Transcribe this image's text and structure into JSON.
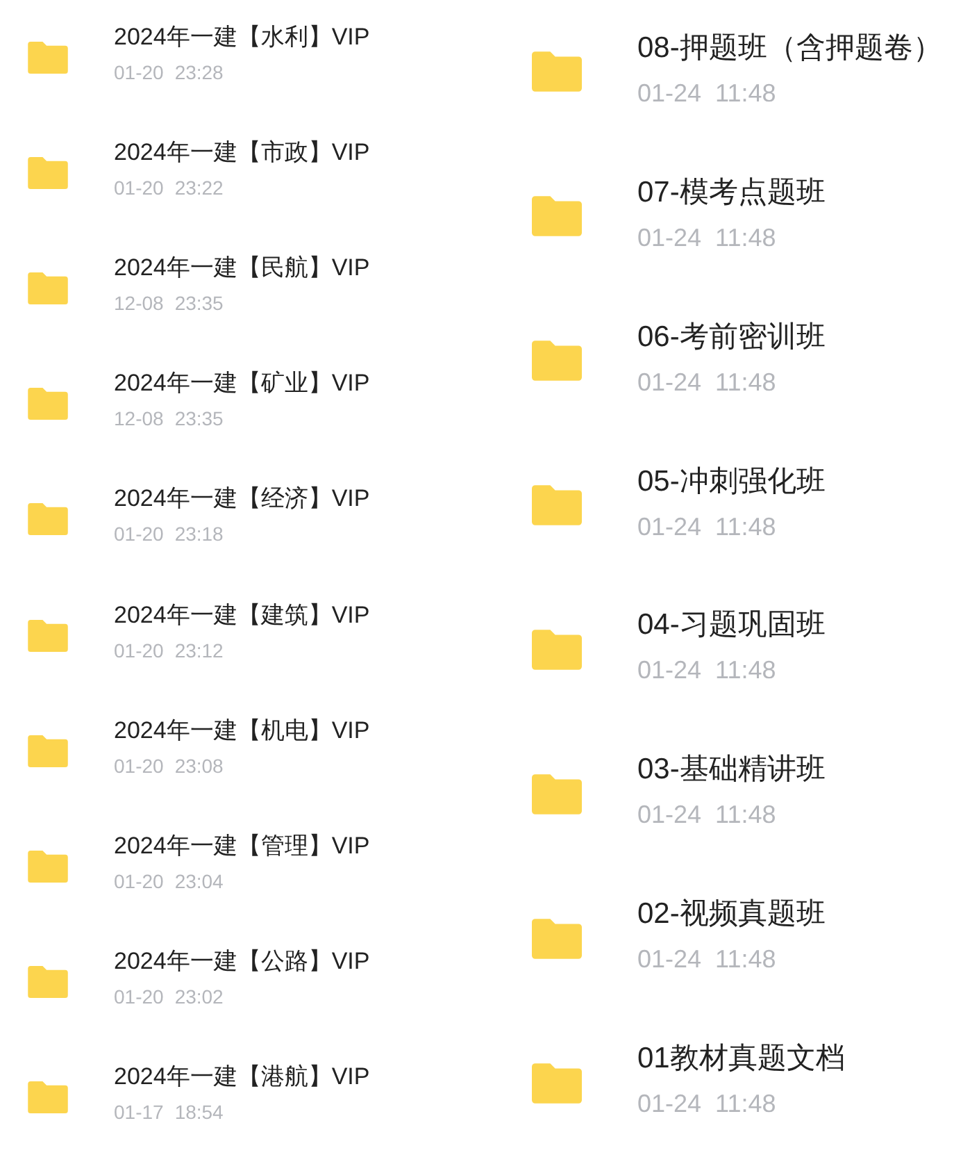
{
  "panels": [
    {
      "items": [
        {
          "name": "2024年一建【水利】VIP",
          "date": "01-20",
          "time": "23:28"
        },
        {
          "name": "2024年一建【市政】VIP",
          "date": "01-20",
          "time": "23:22"
        },
        {
          "name": "2024年一建【民航】VIP",
          "date": "12-08",
          "time": "23:35"
        },
        {
          "name": "2024年一建【矿业】VIP",
          "date": "12-08",
          "time": "23:35"
        },
        {
          "name": "2024年一建【经济】VIP",
          "date": "01-20",
          "time": "23:18"
        },
        {
          "name": "2024年一建【建筑】VIP",
          "date": "01-20",
          "time": "23:12"
        },
        {
          "name": "2024年一建【机电】VIP",
          "date": "01-20",
          "time": "23:08"
        },
        {
          "name": "2024年一建【管理】VIP",
          "date": "01-20",
          "time": "23:04"
        },
        {
          "name": "2024年一建【公路】VIP",
          "date": "01-20",
          "time": "23:02"
        },
        {
          "name": "2024年一建【港航】VIP",
          "date": "01-17",
          "time": "18:54"
        }
      ]
    },
    {
      "items": [
        {
          "name": "08-押题班（含押题卷）",
          "date": "01-24",
          "time": "11:48"
        },
        {
          "name": "07-模考点题班",
          "date": "01-24",
          "time": "11:48"
        },
        {
          "name": "06-考前密训班",
          "date": "01-24",
          "time": "11:48"
        },
        {
          "name": "05-冲刺强化班",
          "date": "01-24",
          "time": "11:48"
        },
        {
          "name": "04-习题巩固班",
          "date": "01-24",
          "time": "11:48"
        },
        {
          "name": "03-基础精讲班",
          "date": "01-24",
          "time": "11:48"
        },
        {
          "name": "02-视频真题班",
          "date": "01-24",
          "time": "11:48"
        },
        {
          "name": "01教材真题文档",
          "date": "01-24",
          "time": "11:48"
        }
      ]
    }
  ]
}
